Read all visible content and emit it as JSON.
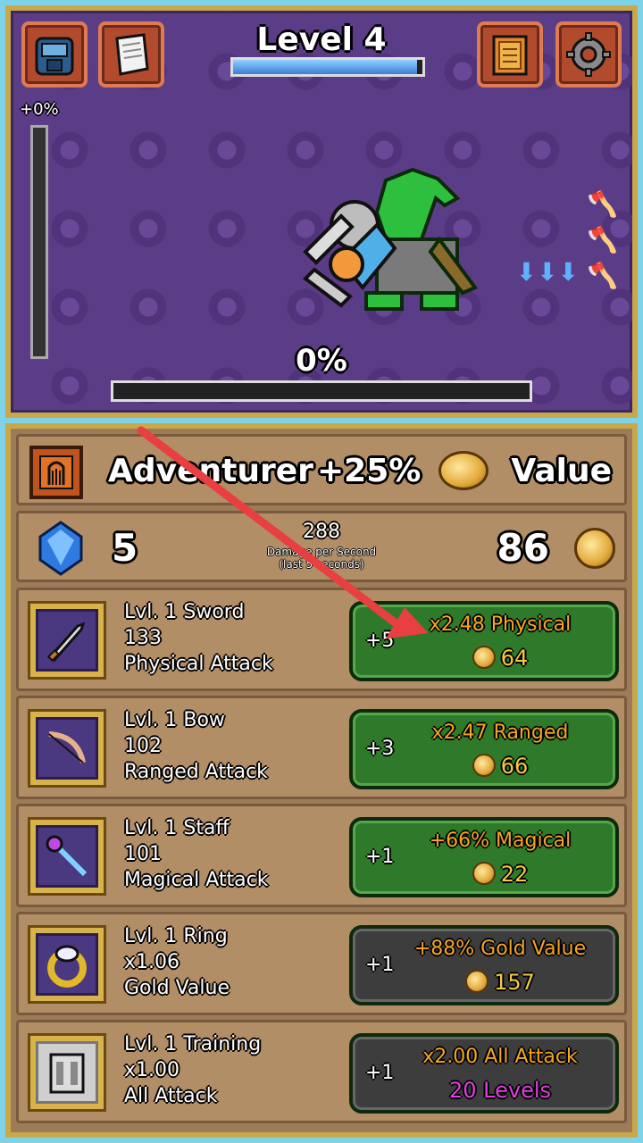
{
  "top_bar": {
    "level_title": "Level 4",
    "level_progress": 0.97,
    "left_buttons": [
      "backpack-icon",
      "scroll-icon"
    ],
    "right_buttons": [
      "book-icon",
      "gear-icon"
    ]
  },
  "battle": {
    "side_gauge_label": "+0%",
    "side_gauge_fill": 0,
    "progress_label": "0%",
    "progress_fill": 0,
    "status_icons": [
      "red-axe-icon",
      "green-axe-icon",
      "blue-arrows-icon",
      "axe-sparkle-icon"
    ]
  },
  "class_row": {
    "name": "Adventurer",
    "bonus": "+25%",
    "value_label": "Value"
  },
  "stats": {
    "gems": "5",
    "dps_value": "288",
    "dps_caption_1": "Damage per Second",
    "dps_caption_2": "(last 5 seconds)",
    "gold": "86"
  },
  "items": [
    {
      "name": "Lvl. 1 Sword",
      "stat": "133",
      "type": "Physical Attack",
      "plus": "+5",
      "effect": "x2.48 Physical",
      "cost": "64",
      "icon": "sword-icon",
      "btn": "green"
    },
    {
      "name": "Lvl. 1 Bow",
      "stat": "102",
      "type": "Ranged Attack",
      "plus": "+3",
      "effect": "x2.47 Ranged",
      "cost": "66",
      "icon": "bow-icon",
      "btn": "green"
    },
    {
      "name": "Lvl. 1 Staff",
      "stat": "101",
      "type": "Magical Attack",
      "plus": "+1",
      "effect": "+66% Magical",
      "cost": "22",
      "icon": "staff-icon",
      "btn": "green"
    },
    {
      "name": "Lvl. 1 Ring",
      "stat": "x1.06",
      "type": "Gold Value",
      "plus": "+1",
      "effect": "+88% Gold Value",
      "cost": "157",
      "icon": "ring-icon",
      "btn": "gray"
    },
    {
      "name": "Lvl. 1 Training",
      "stat": "x1.00",
      "type": "All Attack",
      "plus": "+1",
      "effect": "x2.00 All Attack",
      "cost": "20 Levels",
      "icon": "armor-icon",
      "btn": "gray"
    }
  ],
  "colors": {
    "battle_bg": "#5b3d87",
    "frame_gold": "#c9a84a",
    "button_green": "#2f7a2a",
    "button_gray": "#3d3d3d",
    "effect_orange": "#f5a623",
    "levels_magenta": "#e040e0",
    "annotation_arrow": "#e84040"
  }
}
